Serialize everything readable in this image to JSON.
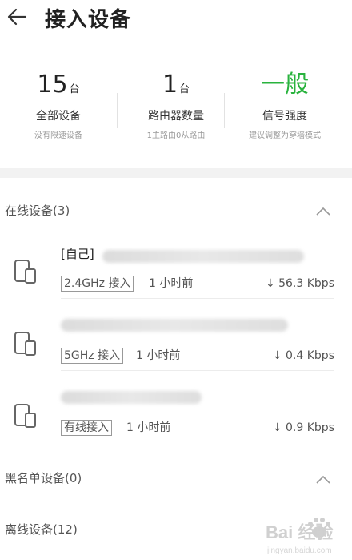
{
  "header": {
    "title": "接入设备"
  },
  "stats": [
    {
      "value": "15",
      "unit": "台",
      "label": "全部设备",
      "sub": "没有限速设备"
    },
    {
      "value": "1",
      "unit": "台",
      "label": "路由器数量",
      "sub": "1主路由0从路由"
    },
    {
      "value": "一般",
      "unit": "",
      "label": "信号强度",
      "sub": "建议调整为穿墙模式"
    }
  ],
  "sections": {
    "online": "在线设备(3)",
    "blacklist": "黑名单设备(0)",
    "offline": "离线设备(12)"
  },
  "devices": [
    {
      "name": "[自己]",
      "connection": "2.4GHz 接入",
      "time": "1 小时前",
      "speed": "↓ 56.3 Kbps"
    },
    {
      "name": "",
      "connection": "5GHz 接入",
      "time": "1 小时前",
      "speed": "↓ 0.4 Kbps"
    },
    {
      "name": "",
      "connection": "有线接入",
      "time": "1 小时前",
      "speed": "↓ 0.9 Kbps"
    }
  ],
  "watermark": {
    "text": "Bai 经验",
    "sub": "jingyan.baidu.com"
  },
  "colors": {
    "accent_green": "#29b33e"
  }
}
